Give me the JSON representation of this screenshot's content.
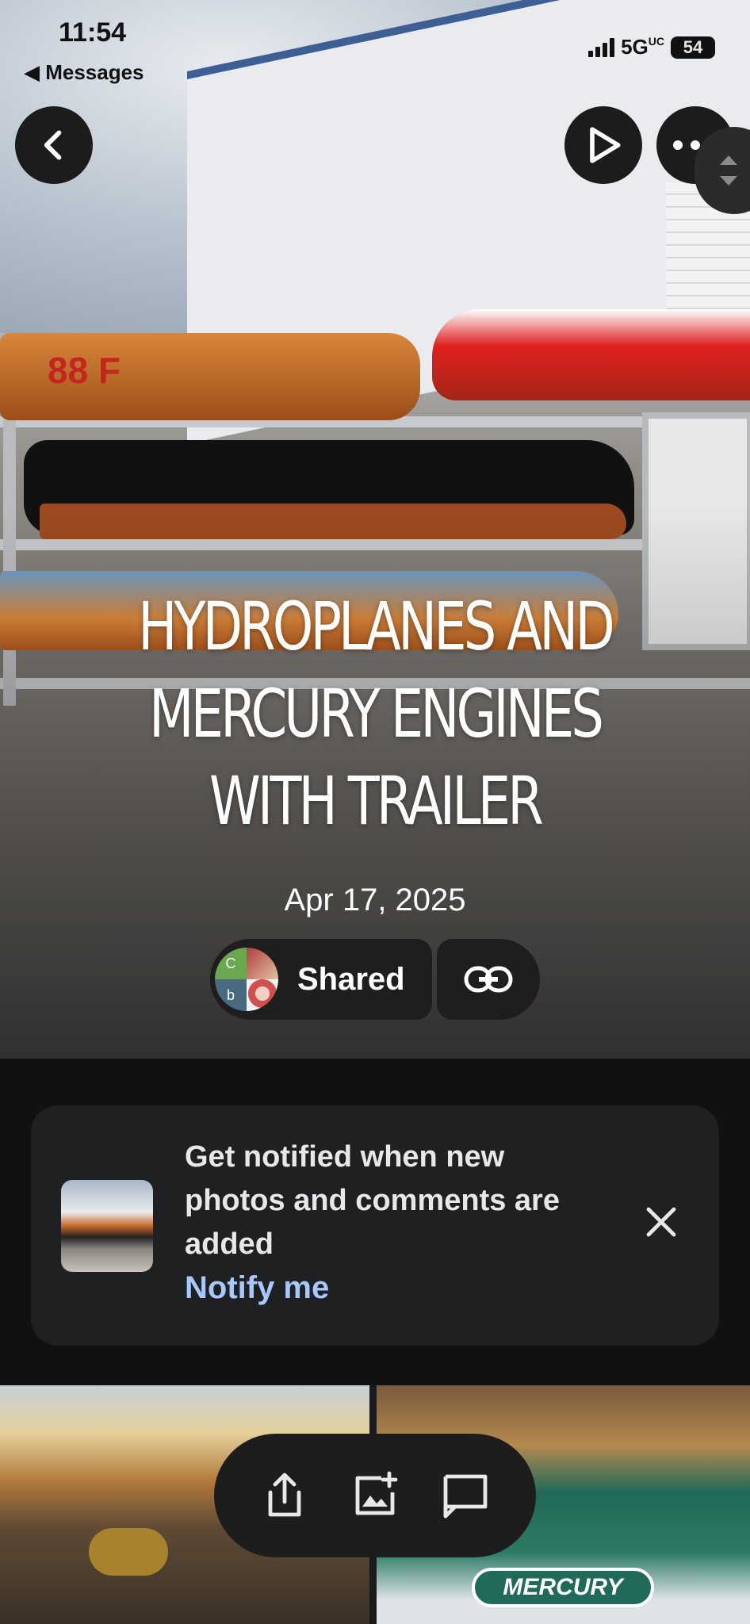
{
  "status_bar": {
    "time": "11:54",
    "back_app": "◀ Messages",
    "network": "5G",
    "network_suffix": "UC",
    "battery": "54"
  },
  "top_bar": {
    "back_icon": "chevron-left-icon",
    "play_icon": "play-icon",
    "more_icon": "more-dots-icon",
    "scroll_icon": "scroll-handle-icon"
  },
  "album": {
    "title": "HYDROPLANES AND MERCURY ENGINES WITH TRAILER",
    "date": "Apr 17, 2025",
    "shared_label": "Shared",
    "avatar_initials": [
      "C",
      "b"
    ],
    "link_icon": "link-icon"
  },
  "hero_photo": {
    "boat_number": "88 F"
  },
  "notification": {
    "text": "Get notified when new photos and comments are added",
    "action": "Notify me",
    "close_icon": "close-icon"
  },
  "grid": {
    "right_tile_caption": "MERCURY"
  },
  "actions": {
    "items": [
      "share-icon",
      "add-photo-icon",
      "comment-icon"
    ]
  },
  "colors": {
    "background": "#111112",
    "card": "#1f2022",
    "link_accent": "#a8c7fa",
    "button": "#1c1c1c"
  }
}
